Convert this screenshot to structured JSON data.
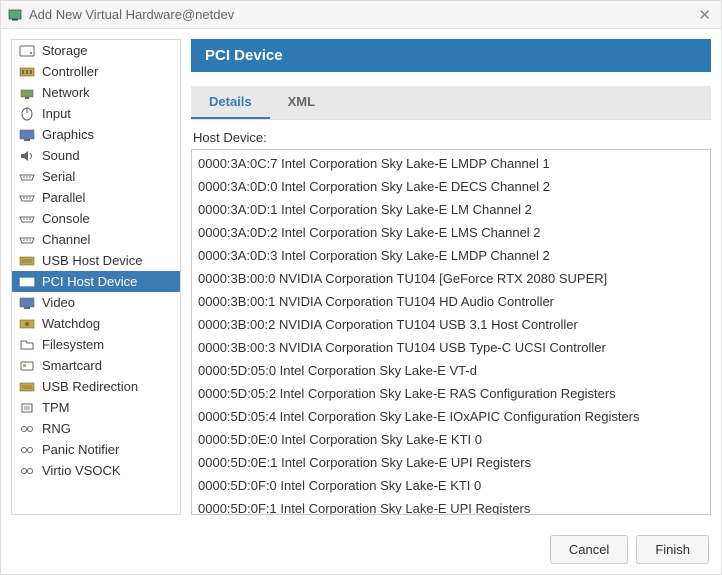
{
  "window": {
    "title": "Add New Virtual Hardware@netdev"
  },
  "sidebar": {
    "items": [
      {
        "label": "Storage",
        "icon": "storage"
      },
      {
        "label": "Controller",
        "icon": "controller"
      },
      {
        "label": "Network",
        "icon": "network"
      },
      {
        "label": "Input",
        "icon": "input"
      },
      {
        "label": "Graphics",
        "icon": "graphics"
      },
      {
        "label": "Sound",
        "icon": "sound"
      },
      {
        "label": "Serial",
        "icon": "serial"
      },
      {
        "label": "Parallel",
        "icon": "parallel"
      },
      {
        "label": "Console",
        "icon": "console"
      },
      {
        "label": "Channel",
        "icon": "channel"
      },
      {
        "label": "USB Host Device",
        "icon": "usb"
      },
      {
        "label": "PCI Host Device",
        "icon": "pci",
        "selected": true
      },
      {
        "label": "Video",
        "icon": "video"
      },
      {
        "label": "Watchdog",
        "icon": "watchdog"
      },
      {
        "label": "Filesystem",
        "icon": "filesystem"
      },
      {
        "label": "Smartcard",
        "icon": "smartcard"
      },
      {
        "label": "USB Redirection",
        "icon": "usb-redir"
      },
      {
        "label": "TPM",
        "icon": "tpm"
      },
      {
        "label": "RNG",
        "icon": "rng"
      },
      {
        "label": "Panic Notifier",
        "icon": "panic"
      },
      {
        "label": "Virtio VSOCK",
        "icon": "vsock"
      }
    ]
  },
  "main": {
    "title": "PCI Device",
    "tabs": [
      {
        "label": "Details",
        "active": true
      },
      {
        "label": "XML",
        "active": false
      }
    ],
    "host_label": "Host Device:"
  },
  "devices": [
    "0000:3A:0C:7 Intel Corporation Sky Lake-E LMDP Channel 1",
    "0000:3A:0D:0 Intel Corporation Sky Lake-E DECS Channel 2",
    "0000:3A:0D:1 Intel Corporation Sky Lake-E LM Channel 2",
    "0000:3A:0D:2 Intel Corporation Sky Lake-E LMS Channel 2",
    "0000:3A:0D:3 Intel Corporation Sky Lake-E LMDP Channel 2",
    "0000:3B:00:0 NVIDIA Corporation TU104 [GeForce RTX 2080 SUPER]",
    "0000:3B:00:1 NVIDIA Corporation TU104 HD Audio Controller",
    "0000:3B:00:2 NVIDIA Corporation TU104 USB 3.1 Host Controller",
    "0000:3B:00:3 NVIDIA Corporation TU104 USB Type-C UCSI Controller",
    "0000:5D:05:0 Intel Corporation Sky Lake-E VT-d",
    "0000:5D:05:2 Intel Corporation Sky Lake-E RAS Configuration Registers",
    "0000:5D:05:4 Intel Corporation Sky Lake-E IOxAPIC Configuration Registers",
    "0000:5D:0E:0 Intel Corporation Sky Lake-E KTI 0",
    "0000:5D:0E:1 Intel Corporation Sky Lake-E UPI Registers",
    "0000:5D:0F:0 Intel Corporation Sky Lake-E KTI 0",
    "0000:5D:0F:1 Intel Corporation Sky Lake-E UPI Registers"
  ],
  "footer": {
    "cancel": "Cancel",
    "finish": "Finish"
  }
}
